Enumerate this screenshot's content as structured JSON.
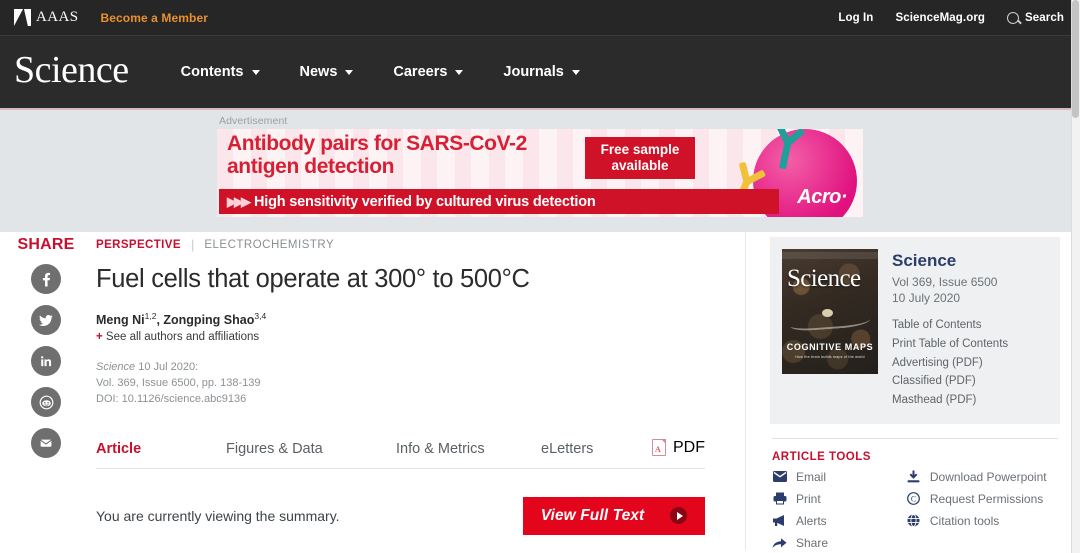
{
  "topbar": {
    "brand": "AAAS",
    "become_member": "Become a Member",
    "login": "Log In",
    "sciencemag": "ScienceMag.org",
    "search": "Search"
  },
  "masthead": {
    "logo": "Science",
    "nav": [
      {
        "label": "Contents"
      },
      {
        "label": "News"
      },
      {
        "label": "Careers"
      },
      {
        "label": "Journals"
      }
    ]
  },
  "ad": {
    "label": "Advertisement",
    "headline_line1": "Antibody pairs for SARS-CoV-2",
    "headline_line2": "antigen detection",
    "badge_line1": "Free sample",
    "badge_line2": "available",
    "strip": "High sensitivity verified by cultured virus detection",
    "strip_chevrons": "▶▶▶",
    "brand": "Acro·"
  },
  "share": {
    "title": "SHARE",
    "items": [
      {
        "name": "facebook",
        "label": "Facebook"
      },
      {
        "name": "twitter",
        "label": "Twitter"
      },
      {
        "name": "linkedin",
        "label": "LinkedIn"
      },
      {
        "name": "reddit",
        "label": "Reddit"
      },
      {
        "name": "email",
        "label": "Email"
      }
    ]
  },
  "article": {
    "kicker_type": "PERSPECTIVE",
    "kicker_sep": "|",
    "kicker_topic": "ELECTROCHEMISTRY",
    "title": "Fuel cells that operate at 300° to 500°C",
    "author1": "Meng Ni",
    "author1_sup": "1,2",
    "author_comma": ", ",
    "author2": "Zongping Shao",
    "author2_sup": "3,4",
    "see_all_plus": "+",
    "see_all": "See all authors and affiliations",
    "journal": "Science",
    "pub_date": "10 Jul 2020:",
    "volume_line": "Vol. 369, Issue 6500, pp. 138-139",
    "doi_line": "DOI: 10.1126/science.abc9136"
  },
  "tabs": [
    {
      "label": "Article",
      "active": true
    },
    {
      "label": "Figures & Data",
      "active": false
    },
    {
      "label": "Info & Metrics",
      "active": false
    },
    {
      "label": "eLetters",
      "active": false
    }
  ],
  "pdf_tab": {
    "label": "PDF",
    "glyph": "A"
  },
  "summary": {
    "text": "You are currently viewing the summary.",
    "button_label": "View Full Text"
  },
  "issue": {
    "cover_title": "Science",
    "cover_caption": "COGNITIVE MAPS",
    "cover_subcaption": "How the brain builds maps of the world",
    "name": "Science",
    "volume": "Vol 369, Issue 6500",
    "date": "10 July 2020",
    "links": [
      {
        "label": "Table of Contents"
      },
      {
        "label": "Print Table of Contents"
      },
      {
        "label": "Advertising (PDF)"
      },
      {
        "label": "Classified (PDF)"
      },
      {
        "label": "Masthead (PDF)"
      }
    ]
  },
  "article_tools": {
    "title": "ARTICLE TOOLS",
    "left": [
      {
        "label": "Email",
        "icon": "envelope-icon"
      },
      {
        "label": "Print",
        "icon": "printer-icon"
      },
      {
        "label": "Alerts",
        "icon": "megaphone-icon"
      },
      {
        "label": "Share",
        "icon": "share-arrow-icon"
      }
    ],
    "right": [
      {
        "label": "Download Powerpoint",
        "icon": "download-icon"
      },
      {
        "label": "Request Permissions",
        "icon": "copyright-icon"
      },
      {
        "label": "Citation tools",
        "icon": "globe-icon"
      }
    ]
  },
  "colors": {
    "accent_red": "#c8102e",
    "brand_orange": "#e8912d",
    "nav_dark": "#2b2b2b",
    "issue_blue": "#2c3d6b",
    "button_red": "#e3051b"
  }
}
